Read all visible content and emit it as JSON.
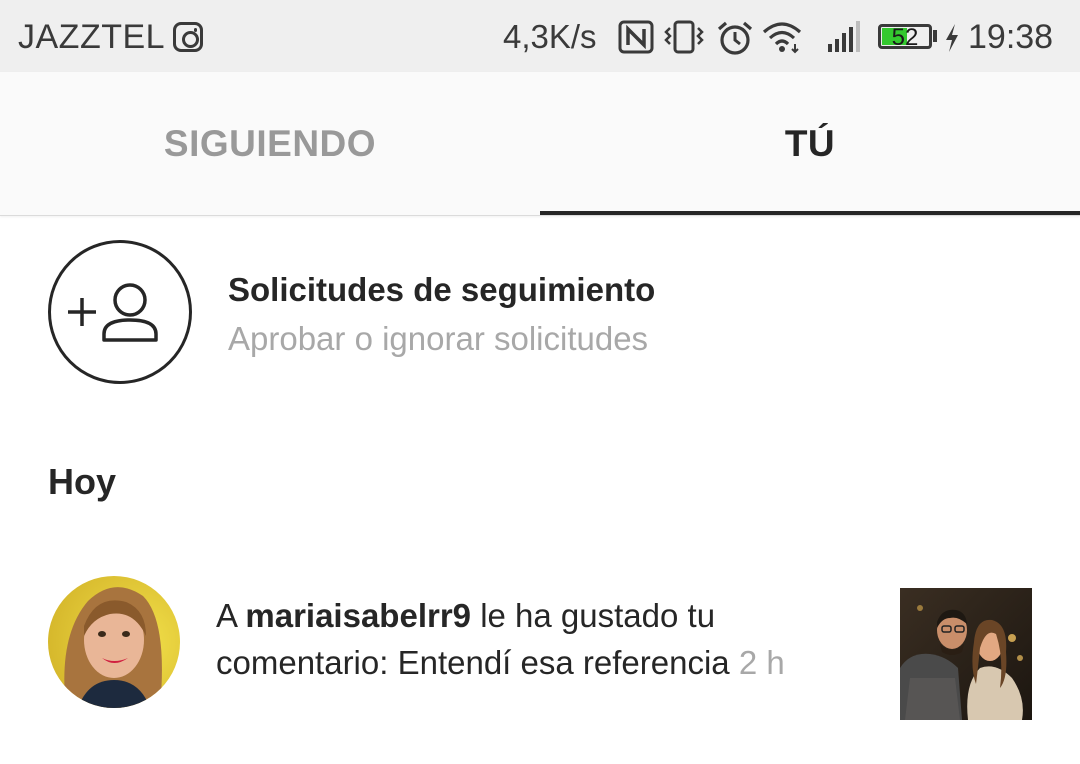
{
  "status_bar": {
    "carrier": "JAZZTEL",
    "speed": "4,3K/s",
    "battery": "52",
    "time": "19:38"
  },
  "tabs": {
    "following": "SIGUIENDO",
    "you": "TÚ",
    "active": "you"
  },
  "follow_requests": {
    "title": "Solicitudes de seguimiento",
    "subtitle": "Aprobar o ignorar solicitudes"
  },
  "sections": {
    "today": "Hoy"
  },
  "notifications": [
    {
      "prefix": "A",
      "username": "mariaisabelrr9",
      "action": "le ha gustado tu comentario: Entendí esa referencia",
      "time": "2 h"
    }
  ],
  "colors": {
    "accent_text": "#262626",
    "secondary_text": "#a8a8a8",
    "inactive_tab": "#999999",
    "status_bar_bg": "#efefef",
    "battery_green": "#34c92f"
  }
}
